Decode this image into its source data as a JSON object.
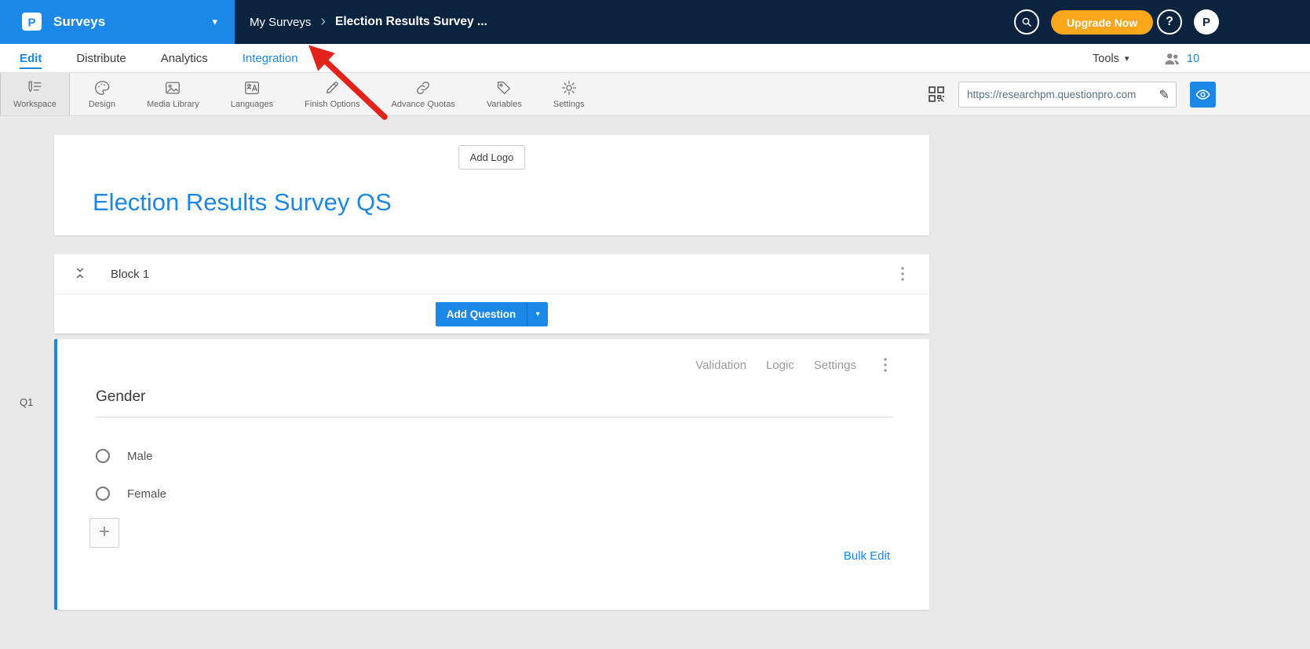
{
  "icons": {
    "caret_down": "▾",
    "breadcrumb_chevron": "›",
    "help_glyph": "?",
    "plus_glyph": "+",
    "pencil_glyph": "✎"
  },
  "header": {
    "app_name": "Surveys",
    "breadcrumb": [
      "My Surveys",
      "Election Results Survey ..."
    ],
    "upgrade_label": "Upgrade Now",
    "avatar_initial": "P"
  },
  "nav": {
    "tabs": [
      {
        "label": "Edit"
      },
      {
        "label": "Distribute"
      },
      {
        "label": "Analytics"
      },
      {
        "label": "Integration"
      }
    ],
    "tools_label": "Tools",
    "collaborator_count": "10"
  },
  "toolbar": {
    "items": [
      {
        "label": "Workspace"
      },
      {
        "label": "Design"
      },
      {
        "label": "Media Library"
      },
      {
        "label": "Languages"
      },
      {
        "label": "Finish Options"
      },
      {
        "label": "Advance Quotas"
      },
      {
        "label": "Variables"
      },
      {
        "label": "Settings"
      }
    ],
    "survey_url": "https://researchpm.questionpro.com"
  },
  "survey": {
    "add_logo_label": "Add Logo",
    "title": "Election Results Survey QS",
    "block": {
      "title": "Block 1",
      "add_question_label": "Add Question"
    },
    "question": {
      "id": "Q1",
      "actions": [
        "Validation",
        "Logic",
        "Settings"
      ],
      "text": "Gender",
      "options": [
        "Male",
        "Female"
      ],
      "bulk_edit_label": "Bulk Edit"
    }
  },
  "colors": {
    "accent_blue": "#1b87e6",
    "navy_header": "#0c2340",
    "upgrade_orange": "#faa61a",
    "annotation_red": "#e2231a"
  }
}
